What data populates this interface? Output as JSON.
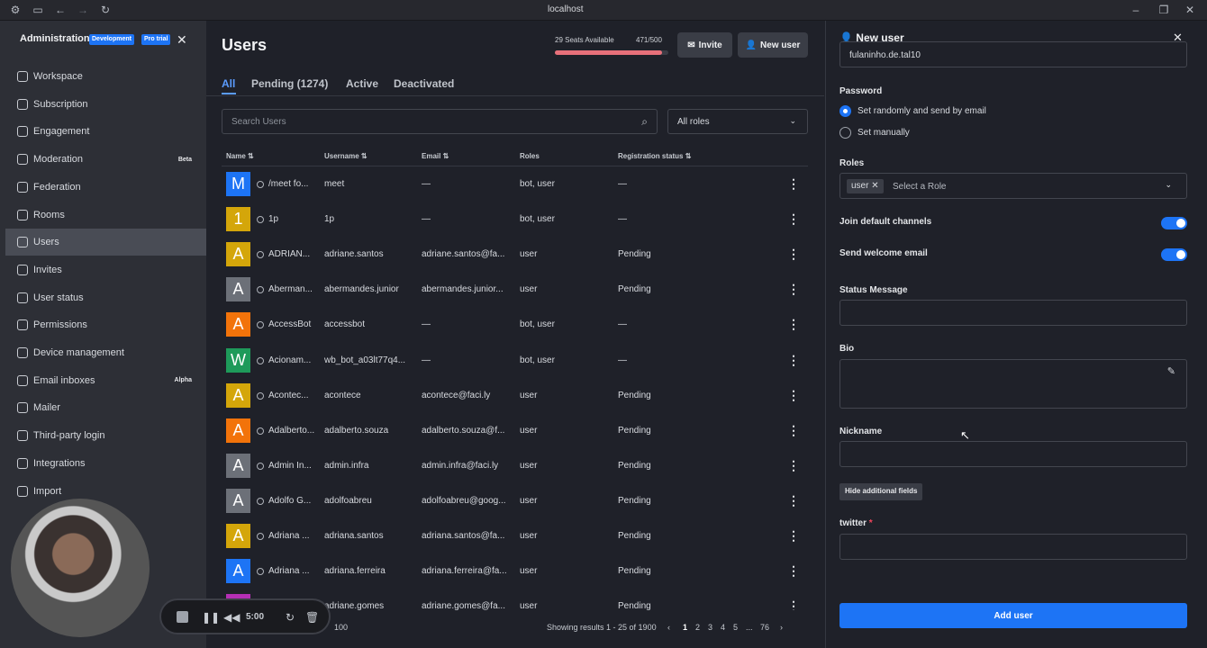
{
  "browser": {
    "url": "localhost"
  },
  "sidebar": {
    "title": "Administration",
    "badge_dev": "Development",
    "badge_pro": "Pro trial",
    "items": [
      {
        "label": "Workspace",
        "icon": "info-icon",
        "tag": ""
      },
      {
        "label": "Subscription",
        "icon": "card-icon",
        "tag": ""
      },
      {
        "label": "Engagement",
        "icon": "chart-icon",
        "tag": ""
      },
      {
        "label": "Moderation",
        "icon": "shield-icon",
        "tag": "Beta"
      },
      {
        "label": "Federation",
        "icon": "globe-icon",
        "tag": ""
      },
      {
        "label": "Rooms",
        "icon": "hash-icon",
        "tag": ""
      },
      {
        "label": "Users",
        "icon": "team-icon",
        "tag": ""
      },
      {
        "label": "Invites",
        "icon": "user-plus-icon",
        "tag": ""
      },
      {
        "label": "User status",
        "icon": "user-icon",
        "tag": ""
      },
      {
        "label": "Permissions",
        "icon": "key-icon",
        "tag": ""
      },
      {
        "label": "Device management",
        "icon": "desktop-icon",
        "tag": ""
      },
      {
        "label": "Email inboxes",
        "icon": "mail-icon",
        "tag": "Alpha"
      },
      {
        "label": "Mailer",
        "icon": "send-icon",
        "tag": ""
      },
      {
        "label": "Third-party login",
        "icon": "login-icon",
        "tag": ""
      },
      {
        "label": "Integrations",
        "icon": "code-icon",
        "tag": ""
      },
      {
        "label": "Import",
        "icon": "import-icon",
        "tag": ""
      }
    ]
  },
  "main": {
    "title": "Users",
    "seats_available": "29 Seats Available",
    "seats_count": "471/500",
    "seats_fraction": 0.942,
    "invite_label": "Invite",
    "new_user_label": "New user",
    "tabs": [
      "All",
      "Pending (1274)",
      "Active",
      "Deactivated"
    ],
    "search_placeholder": "Search Users",
    "roles_filter": "All roles",
    "columns": [
      "Name",
      "Username",
      "Email",
      "Roles",
      "Registration status"
    ],
    "rows": [
      {
        "initial": "M",
        "color": "#1d74f5",
        "name": "/meet fo...",
        "username": "meet",
        "email": "—",
        "roles": "bot, user",
        "status": "—"
      },
      {
        "initial": "1",
        "color": "#d4a60a",
        "name": "1p",
        "username": "1p",
        "email": "—",
        "roles": "bot, user",
        "status": "—"
      },
      {
        "initial": "A",
        "color": "#d4a60a",
        "name": "ADRIAN...",
        "username": "adriane.santos",
        "email": "adriane.santos@fa...",
        "roles": "user",
        "status": "Pending"
      },
      {
        "initial": "A",
        "color": "#6c7078",
        "name": "Aberman...",
        "username": "abermandes.junior",
        "email": "abermandes.junior...",
        "roles": "user",
        "status": "Pending"
      },
      {
        "initial": "A",
        "color": "#f2730a",
        "name": "AccessBot",
        "username": "accessbot",
        "email": "—",
        "roles": "bot, user",
        "status": "—"
      },
      {
        "initial": "W",
        "color": "#1e9a5a",
        "name": "Acionam...",
        "username": "wb_bot_a03lt77q4...",
        "email": "—",
        "roles": "bot, user",
        "status": "—"
      },
      {
        "initial": "A",
        "color": "#d4a60a",
        "name": "Acontec...",
        "username": "acontece",
        "email": "acontece@faci.ly",
        "roles": "user",
        "status": "Pending"
      },
      {
        "initial": "A",
        "color": "#f2730a",
        "name": "Adalberto...",
        "username": "adalberto.souza",
        "email": "adalberto.souza@f...",
        "roles": "user",
        "status": "Pending"
      },
      {
        "initial": "A",
        "color": "#6c7078",
        "name": "Admin In...",
        "username": "admin.infra",
        "email": "admin.infra@faci.ly",
        "roles": "user",
        "status": "Pending"
      },
      {
        "initial": "A",
        "color": "#6c7078",
        "name": "Adolfo G...",
        "username": "adolfoabreu",
        "email": "adolfoabreu@goog...",
        "roles": "user",
        "status": "Pending"
      },
      {
        "initial": "A",
        "color": "#d4a60a",
        "name": "Adriana ...",
        "username": "adriana.santos",
        "email": "adriana.santos@fa...",
        "roles": "user",
        "status": "Pending"
      },
      {
        "initial": "A",
        "color": "#1d74f5",
        "name": "Adriana ...",
        "username": "adriana.ferreira",
        "email": "adriana.ferreira@fa...",
        "roles": "user",
        "status": "Pending"
      },
      {
        "initial": "",
        "color": "#b52fb5",
        "name": "",
        "username": "adriane.gomes",
        "email": "adriane.gomes@fa...",
        "roles": "user",
        "status": "Pending"
      }
    ],
    "pager": {
      "per_page": "100",
      "results": "Showing results 1 - 25 of 1900",
      "pages": [
        "1",
        "2",
        "3",
        "4",
        "5",
        "...",
        "76"
      ]
    }
  },
  "panel": {
    "title": "New user",
    "email_value": "fulaninho.de.tal10",
    "password_label": "Password",
    "radio_random": "Set randomly and send by email",
    "radio_manual": "Set manually",
    "roles_label": "Roles",
    "role_chip": "user",
    "roles_placeholder": "Select a Role",
    "join_channels": "Join default channels",
    "welcome_email": "Send welcome email",
    "status_label": "Status Message",
    "bio_label": "Bio",
    "nickname_label": "Nickname",
    "hide_fields": "Hide additional fields",
    "twitter_label": "twitter",
    "required_mark": "*",
    "add_user": "Add user"
  },
  "recorder": {
    "time": "5:00"
  }
}
